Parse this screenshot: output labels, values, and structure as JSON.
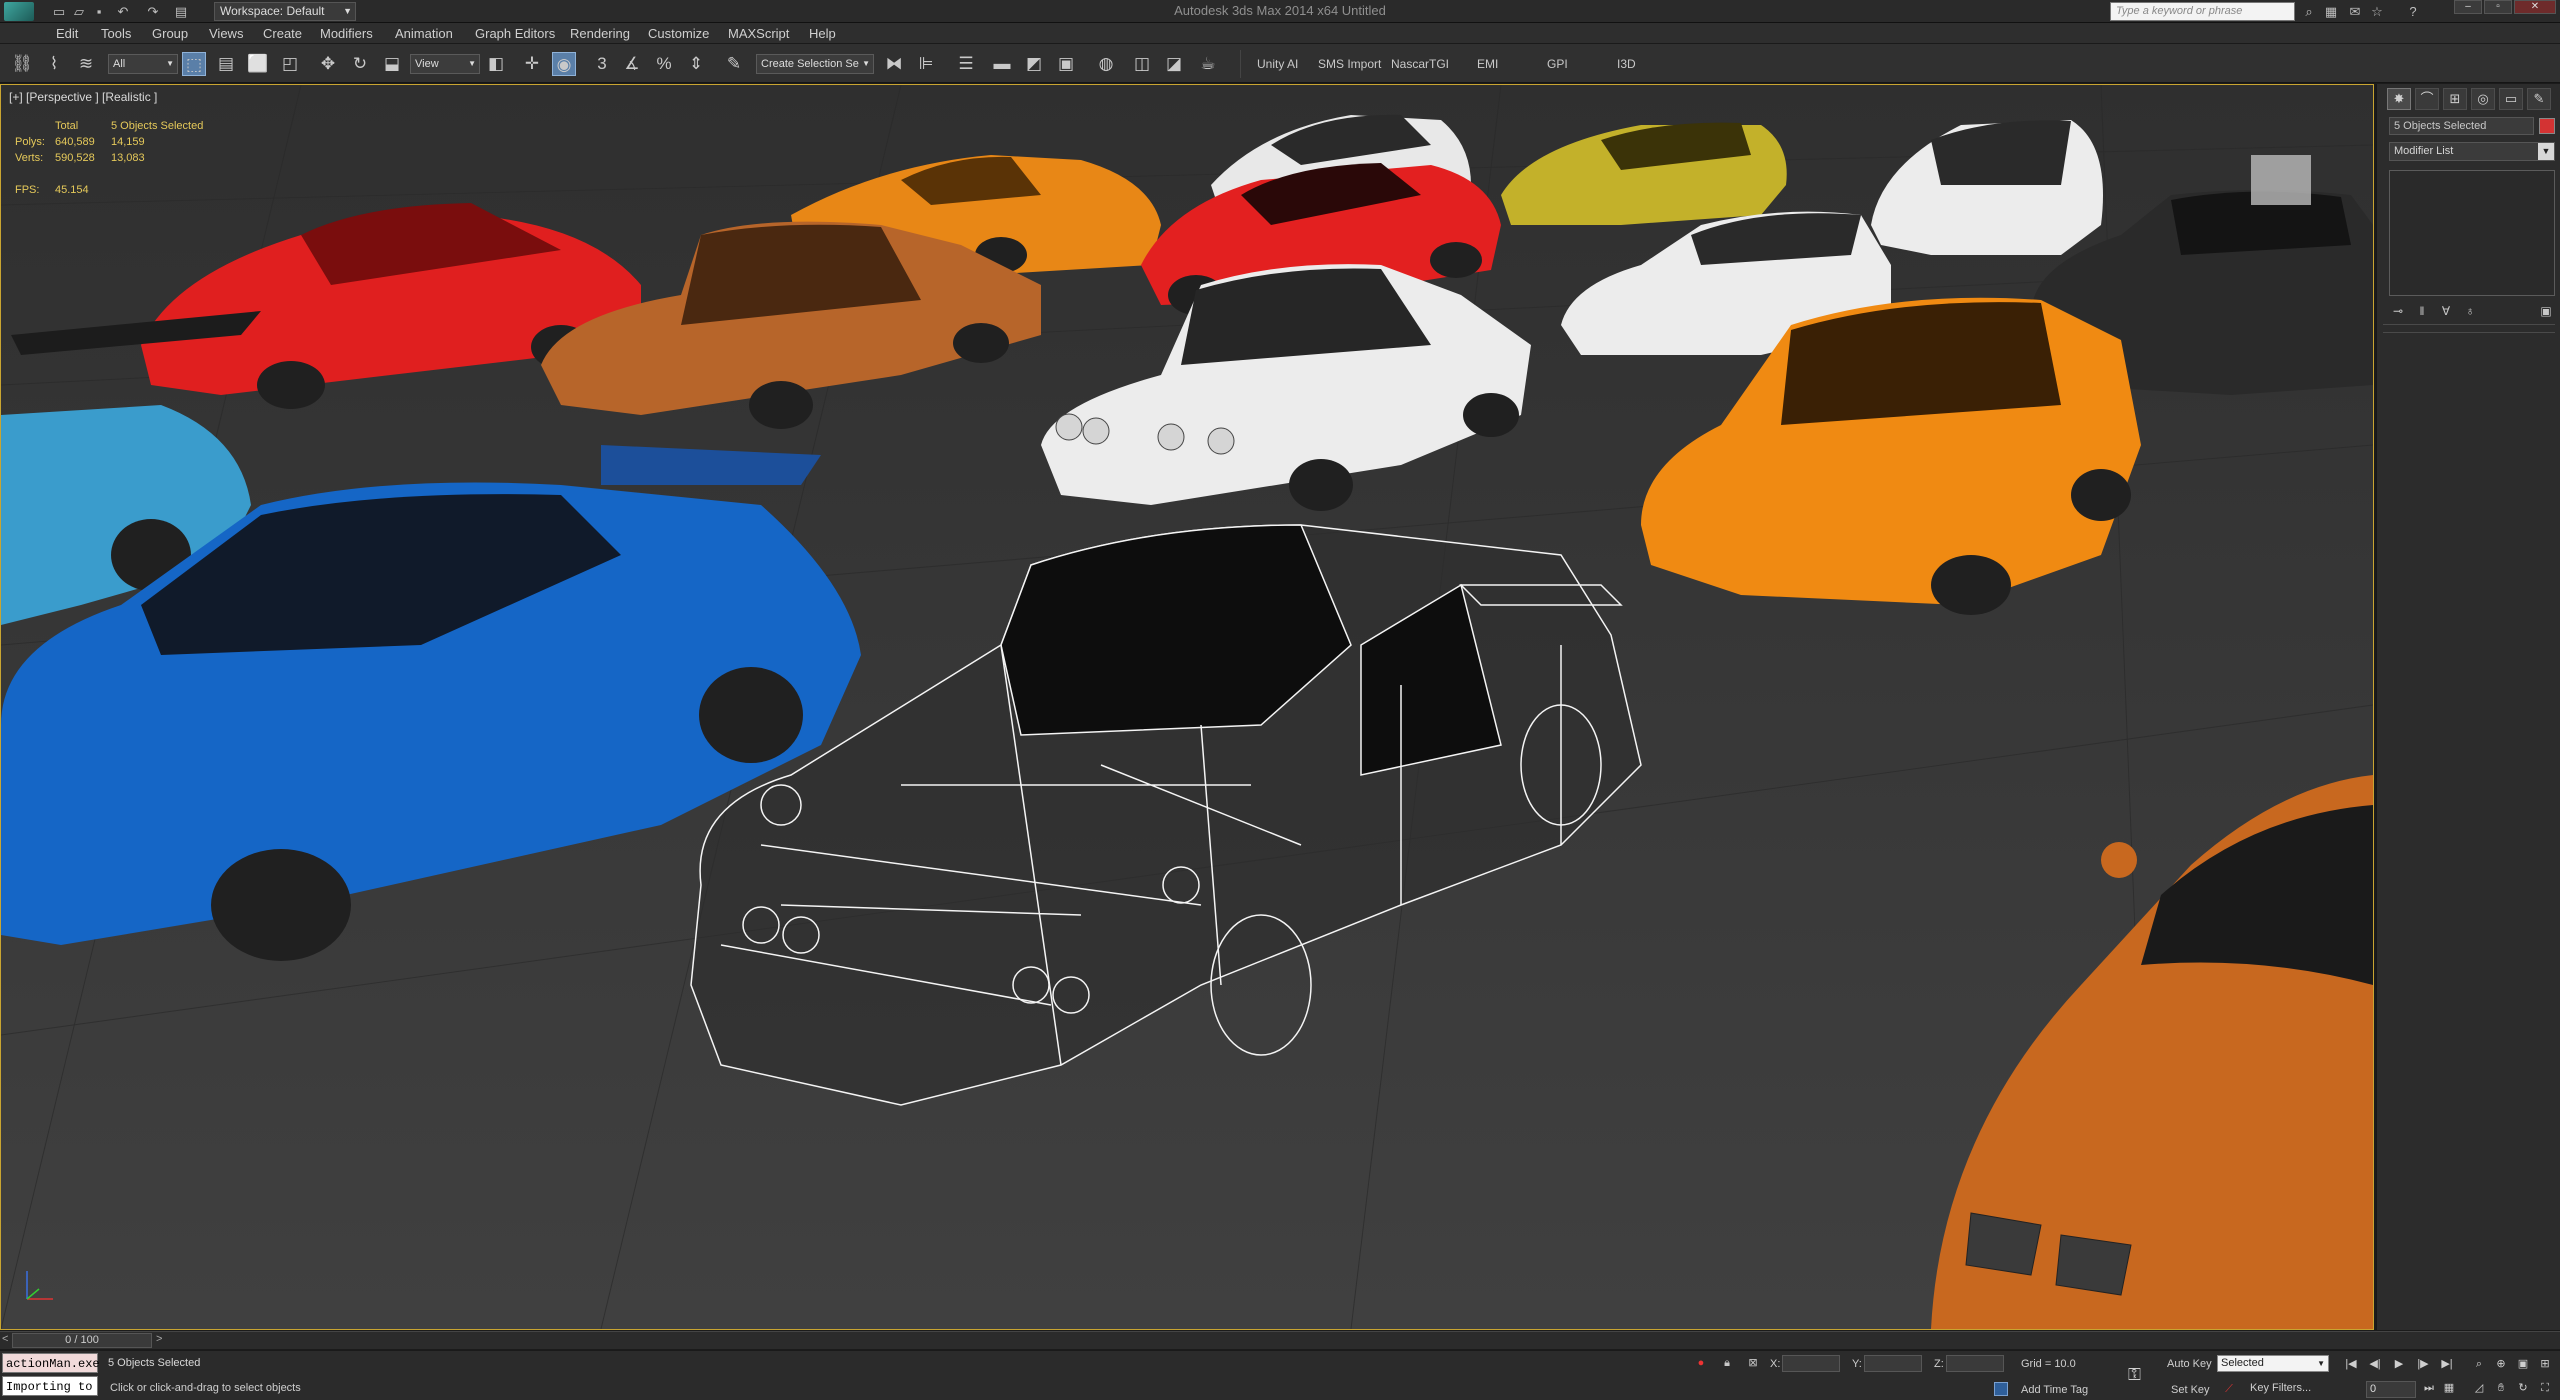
{
  "app": {
    "title": "Autodesk 3ds Max 2014 x64      Untitled",
    "workspace": "Workspace: Default",
    "search_placeholder": "Type a keyword or phrase"
  },
  "menu": [
    "Edit",
    "Tools",
    "Group",
    "Views",
    "Create",
    "Modifiers",
    "Animation",
    "Graph Editors",
    "Rendering",
    "Customize",
    "MAXScript",
    "Help"
  ],
  "toolbar": {
    "selection_filter": "All",
    "reference_coord": "View",
    "named_selection": "Create Selection Se",
    "plugin_buttons": [
      "Unity AI",
      "SMS Import",
      "NascarTGI",
      "EMI",
      "GPI",
      "I3D"
    ]
  },
  "viewport": {
    "label": "[+] [Perspective ] [Realistic ]",
    "stats": {
      "header": "Total",
      "selected_header": "5 Objects Selected",
      "polys_label": "Polys:",
      "polys_total": "640,589",
      "polys_selected": "14,159",
      "verts_label": "Verts:",
      "verts_total": "590,528",
      "verts_selected": "13,083",
      "fps_label": "FPS:",
      "fps_value": "45.154"
    }
  },
  "command_panel": {
    "tabs": [
      "create-tab",
      "modify-tab",
      "hierarchy-tab",
      "motion-tab",
      "display-tab",
      "utilities-tab"
    ],
    "object_name": "5 Objects Selected",
    "object_color": "#d33333",
    "modifier_list": "Modifier List"
  },
  "timeline": {
    "slider": "0 / 100"
  },
  "status": {
    "maxscript_input": "actionMan.exe",
    "maxscript_output": "Importing to",
    "selected": "5 Objects Selected",
    "prompt": "Click or click-and-drag to select objects",
    "x_label": "X:",
    "y_label": "Y:",
    "z_label": "Z:",
    "grid": "Grid = 10.0",
    "add_time_tag": "Add Time Tag",
    "auto_key": "Auto Key",
    "set_key": "Set Key",
    "key_mode": "Selected",
    "key_filters": "Key Filters...",
    "frame": "0"
  },
  "colors": {
    "viewport_bg": "#3b3b3b",
    "viewport_border": "#c9a531",
    "stats_text": "#e5c95a"
  }
}
